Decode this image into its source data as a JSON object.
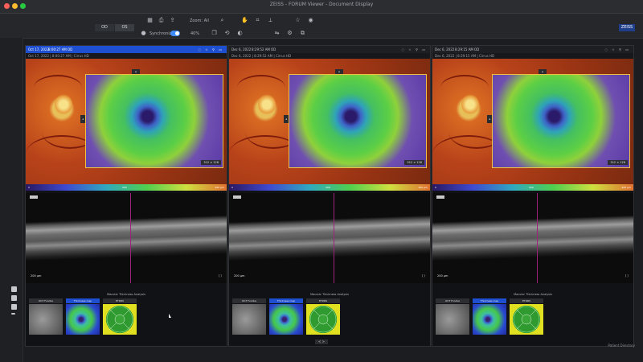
{
  "window": {
    "title": "ZEISS - FORUM Viewer - Document Display"
  },
  "toolbar": {
    "eye_left": "OD",
    "eye_right": "OS",
    "zoom_label": "Zoom: All",
    "synchronize_label": "Synchronize",
    "sync_percent": "40%",
    "brand": "ZEISS"
  },
  "panels": [
    {
      "date": "Oct 17, 2022",
      "time": "8:00:27 AM",
      "scan": "OD",
      "subbar": "Oct 17, 2022  |  8:00:27 AM  |  Cirrus HD",
      "map_tag": "512 × 128",
      "scale_left": "0",
      "scale_mid": "200",
      "scale_right": "400 µm",
      "scalebar": "200 µm",
      "footer": "Macular Thickness Analysis",
      "thumbs": [
        "OCT Fundus",
        "Thickness map",
        "ETDRS"
      ],
      "active": true
    },
    {
      "date": "Dec 6, 2022",
      "time": "8:29:52 AM",
      "scan": "OD",
      "subbar": "Dec 6, 2022  |  8:29:52 AM  |  Cirrus HD",
      "map_tag": "512 × 128",
      "scale_left": "0",
      "scale_mid": "200",
      "scale_right": "400 µm",
      "scalebar": "200 µm",
      "footer": "Macular Thickness Analysis",
      "thumbs": [
        "OCT Fundus",
        "Thickness map",
        "ETDRS"
      ],
      "active": false
    },
    {
      "date": "Dec 6, 2022",
      "time": "8:29:15 AM",
      "scan": "OD",
      "subbar": "Dec 6, 2022  |  8:29:15 AM  |  Cirrus HD",
      "map_tag": "512 × 128",
      "scale_left": "0",
      "scale_mid": "200",
      "scale_right": "400 µm",
      "scalebar": "200 µm",
      "footer": "Macular Thickness Analysis",
      "thumbs": [
        "OCT Fundus",
        "Thickness map",
        "ETDRS"
      ],
      "active": false
    }
  ],
  "pager": "< >",
  "watermark": "Patient Directory",
  "icons": [
    "grid-icon",
    "printer-icon",
    "export-icon",
    "zoom-icon",
    "hand-icon",
    "eye-icon",
    "layers-icon",
    "settings-icon"
  ]
}
